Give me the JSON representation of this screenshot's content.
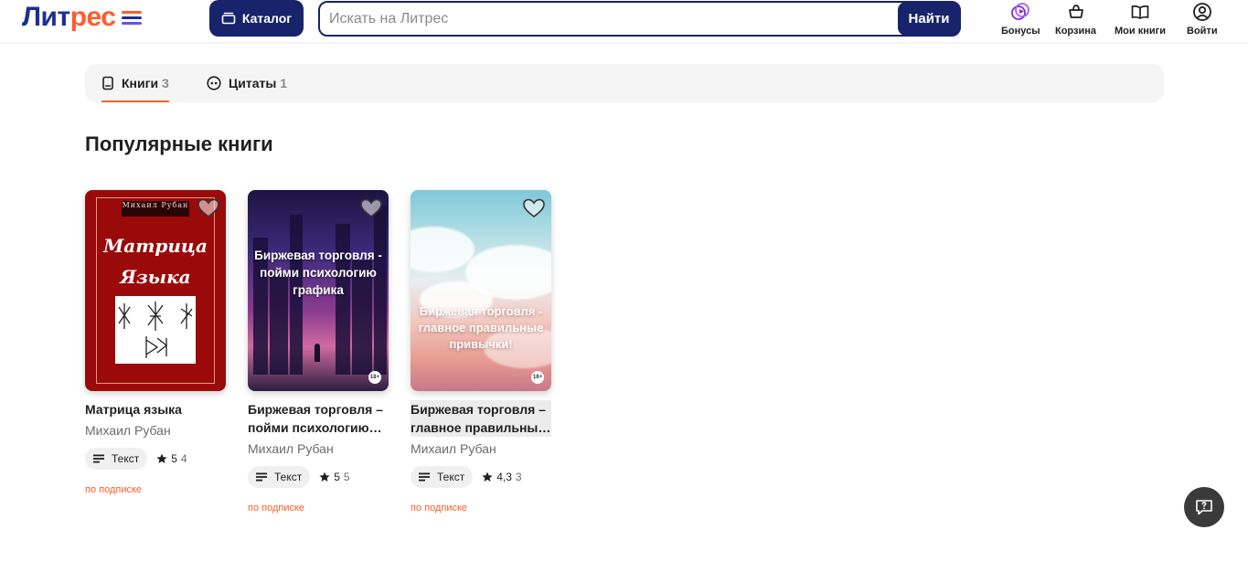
{
  "header": {
    "logo": {
      "part1": "Лит",
      "part2": "рес"
    },
    "catalog_label": "Каталог",
    "search": {
      "placeholder": "Искать на Литрес",
      "value": "",
      "button_label": "Найти"
    },
    "nav": [
      {
        "label": "Бонусы",
        "icon": "bonus-icon"
      },
      {
        "label": "Корзина",
        "icon": "basket-icon"
      },
      {
        "label": "Мои книги",
        "icon": "book-open-icon"
      },
      {
        "label": "Войти",
        "icon": "user-icon"
      }
    ],
    "colors": {
      "brand": "#17246b",
      "accent": "#ff5c2b"
    }
  },
  "tabs": [
    {
      "label": "Книги",
      "count": "3",
      "icon": "book-icon",
      "active": true
    },
    {
      "label": "Цитаты",
      "count": "1",
      "icon": "quote-icon",
      "active": false
    }
  ],
  "section_title": "Популярные книги",
  "books": [
    {
      "title": "Матрица языка",
      "author": "Михаил Рубан",
      "format": "Текст",
      "rating": "5",
      "rating_count": "4",
      "availability": "по подписке",
      "cover": {
        "author": "Михаил Рубан",
        "title_line1": "Матрица",
        "title_line2": "Языка"
      }
    },
    {
      "title_line1": "Биржевая торговля –",
      "title_line2": "пойми психологию…",
      "author": "Михаил Рубан",
      "format": "Текст",
      "rating": "5",
      "rating_count": "5",
      "availability": "по подписке",
      "cover": {
        "title": "Биржевая торговля - пойми психологию графика",
        "age": "18+"
      }
    },
    {
      "title_line1": "Биржевая торговля –",
      "title_line2": "главное правильны…",
      "author": "Михаил Рубан",
      "format": "Текст",
      "rating": "4,3",
      "rating_count": "3",
      "availability": "по подписке",
      "cover": {
        "title": "Биржевая торговля - главное правильные привычки!",
        "age": "18+"
      }
    }
  ],
  "help_icon": "chat-help-icon"
}
